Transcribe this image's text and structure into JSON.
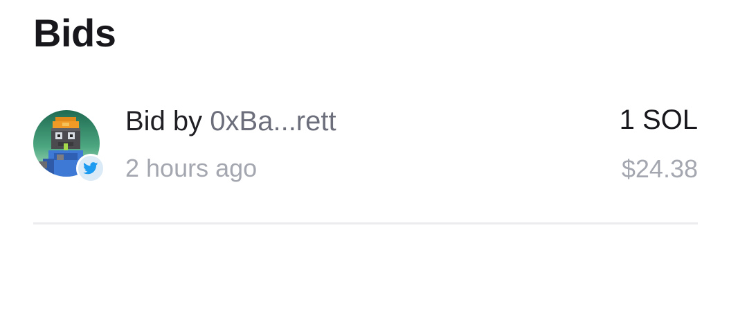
{
  "section": {
    "title": "Bids"
  },
  "bids": [
    {
      "prefix": "Bid by",
      "bidder": "0xBa...rett",
      "time": "2 hours ago",
      "amount": "1 SOL",
      "usd": "$24.38",
      "avatar_icon": "pixel-robot-avatar",
      "badge_icon": "twitter-icon"
    }
  ],
  "colors": {
    "title": "#17171c",
    "bidder": "#6c6f7b",
    "muted": "#a4a7b0",
    "twitter": "#1d9bf0",
    "badge_bg": "#dbeaf7"
  }
}
